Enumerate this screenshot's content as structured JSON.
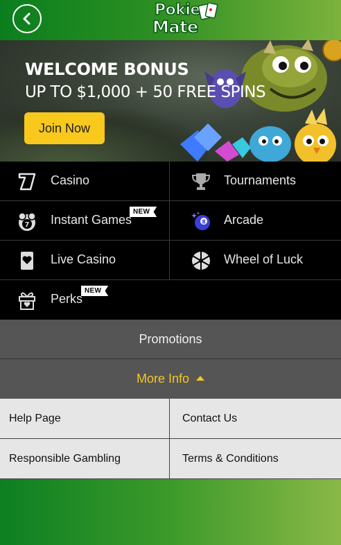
{
  "header": {
    "back_icon": "chevron-left-icon",
    "logo_line1": "Pokie",
    "logo_line2": "Mate"
  },
  "banner": {
    "title": "WELCOME BONUS",
    "subtitle": "UP TO $1,000 + 50 FREE SPINS",
    "cta_label": "Join Now",
    "cta_color": "#f8c81d"
  },
  "menu": {
    "items": [
      {
        "label": "Casino",
        "icon": "slot-seven-icon"
      },
      {
        "label": "Tournaments",
        "icon": "trophy-icon"
      },
      {
        "label": "Instant Games",
        "icon": "lottery-ball-icon",
        "badge": "NEW"
      },
      {
        "label": "Arcade",
        "icon": "eight-ball-icon"
      },
      {
        "label": "Live Casino",
        "icon": "playing-card-icon"
      },
      {
        "label": "Wheel of Luck",
        "icon": "wheel-icon"
      },
      {
        "label": "Perks",
        "icon": "gift-icon",
        "badge": "NEW"
      }
    ]
  },
  "promotions_label": "Promotions",
  "more_info": {
    "label": "More Info",
    "accent": "#f6c623",
    "links": [
      {
        "label": "Help Page"
      },
      {
        "label": "Contact Us"
      },
      {
        "label": "Responsible Gambling"
      },
      {
        "label": "Terms & Conditions"
      }
    ]
  },
  "colors": {
    "header_green": "#0b7e1e",
    "menu_bg": "#000000",
    "section_gray": "#555555",
    "links_bg": "#e6e6e6"
  }
}
